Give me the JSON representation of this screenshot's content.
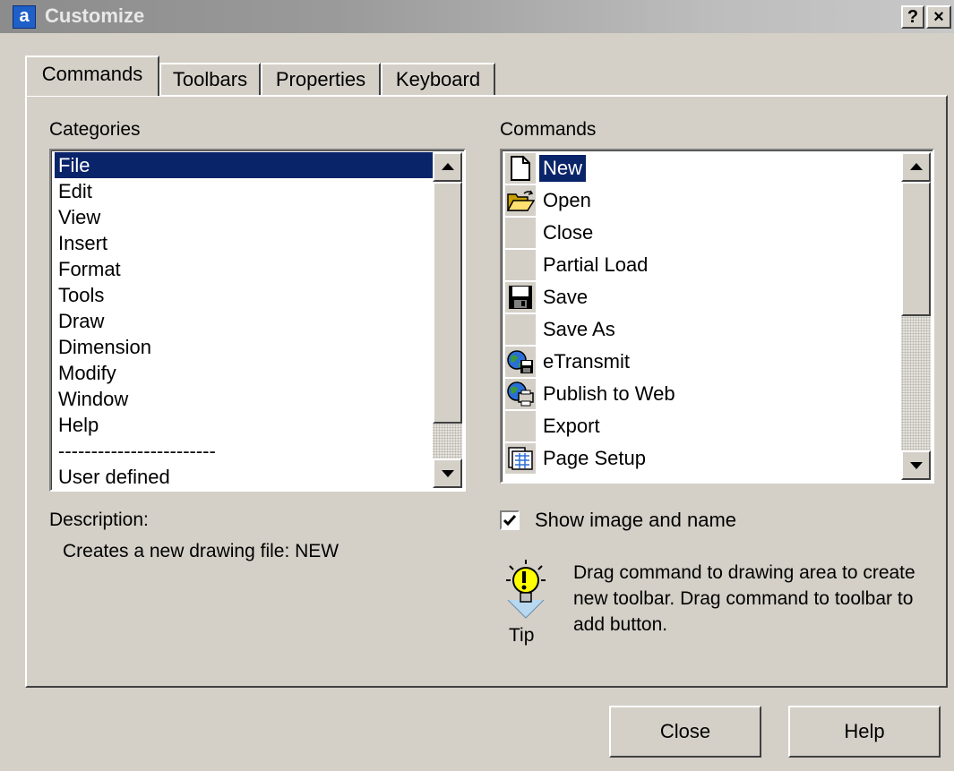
{
  "window": {
    "title": "Customize",
    "app_icon_letter": "a",
    "help_button": "?",
    "close_button": "×"
  },
  "tabs": [
    {
      "label": "Commands",
      "active": true
    },
    {
      "label": "Toolbars",
      "active": false
    },
    {
      "label": "Properties",
      "active": false
    },
    {
      "label": "Keyboard",
      "active": false
    }
  ],
  "categories": {
    "label": "Categories",
    "items": [
      "File",
      "Edit",
      "View",
      "Insert",
      "Format",
      "Tools",
      "Draw",
      "Dimension",
      "Modify",
      "Window",
      "Help",
      "------------------------",
      "User defined"
    ],
    "selected": "File"
  },
  "commands": {
    "label": "Commands",
    "items": [
      {
        "label": "New",
        "icon": "new-document-icon",
        "selected": true
      },
      {
        "label": "Open",
        "icon": "open-folder-icon"
      },
      {
        "label": "Close",
        "icon": ""
      },
      {
        "label": "Partial Load",
        "icon": ""
      },
      {
        "label": "Save",
        "icon": "save-disk-icon"
      },
      {
        "label": "Save As",
        "icon": ""
      },
      {
        "label": "eTransmit",
        "icon": "etransmit-icon"
      },
      {
        "label": "Publish to Web",
        "icon": "publish-web-icon"
      },
      {
        "label": "Export",
        "icon": ""
      },
      {
        "label": "Page Setup",
        "icon": "page-setup-icon"
      }
    ]
  },
  "description": {
    "label": "Description:",
    "text": "Creates a new drawing file:  NEW"
  },
  "show_image_and_name": {
    "label": "Show image and name",
    "checked": true
  },
  "tip": {
    "caption": "Tip",
    "text": "Drag command to drawing area to create new toolbar. Drag command to toolbar to add button."
  },
  "buttons": {
    "close": "Close",
    "help": "Help"
  }
}
